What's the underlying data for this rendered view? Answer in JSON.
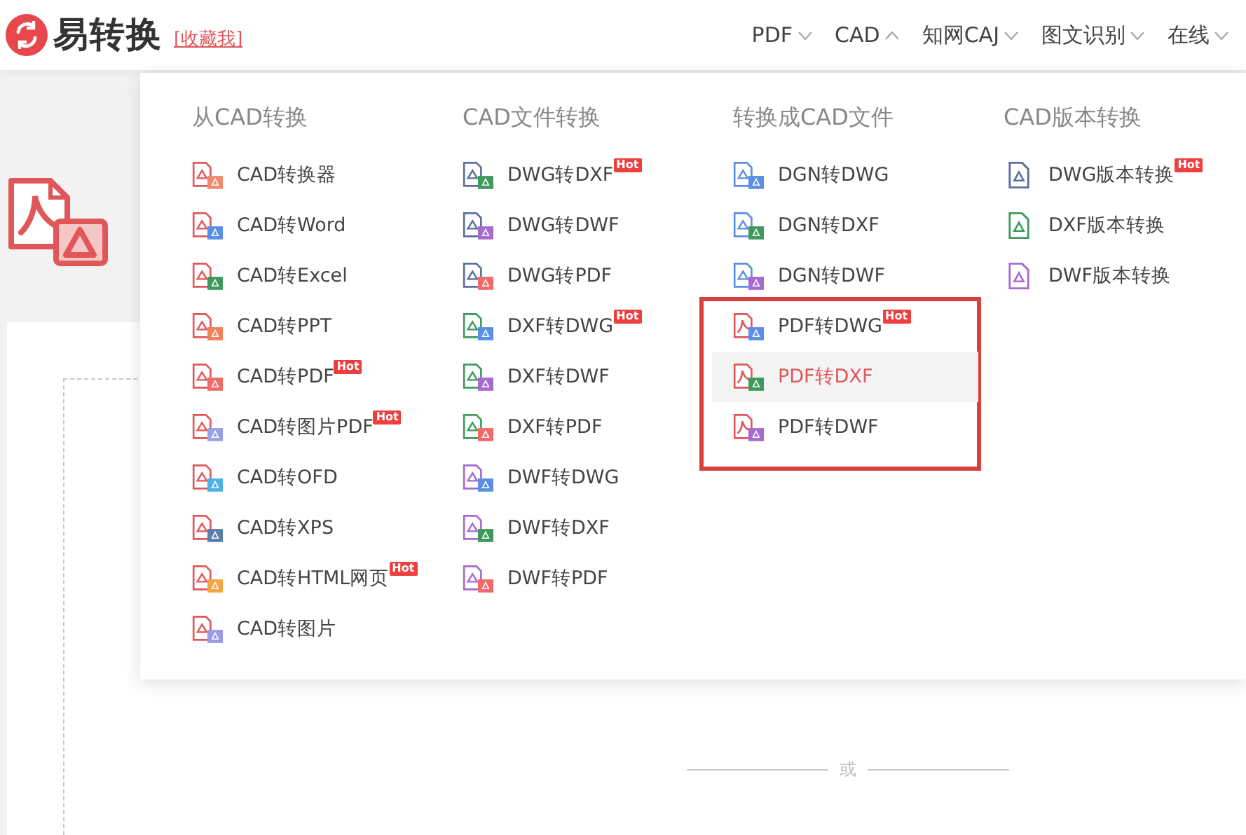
{
  "header": {
    "logo": "易转换",
    "bookmark": "[收藏我]",
    "nav": [
      {
        "label": "PDF",
        "expanded": false
      },
      {
        "label": "CAD",
        "expanded": true
      },
      {
        "label": "知网CAJ",
        "expanded": false
      },
      {
        "label": "图文识别",
        "expanded": false
      },
      {
        "label": "在线",
        "expanded": false
      }
    ]
  },
  "dropdown": {
    "columns": [
      {
        "title": "从CAD转换",
        "items": [
          {
            "label": "CAD转换器",
            "kind": "cad",
            "color": "#f08a6c",
            "selected": false
          },
          {
            "label": "CAD转Word",
            "kind": "cad",
            "color": "#5b8ee6",
            "selected": false
          },
          {
            "label": "CAD转Excel",
            "kind": "cad",
            "color": "#3e9a5c",
            "selected": false
          },
          {
            "label": "CAD转PPT",
            "kind": "cad",
            "color": "#f0805a",
            "selected": false
          },
          {
            "label": "CAD转PDF",
            "badge": "Hot",
            "kind": "cad",
            "color": "#f06a6a",
            "selected": false
          },
          {
            "label": "CAD转图片PDF",
            "badge": "Hot",
            "kind": "cad",
            "color": "#9aa0e8",
            "selected": false
          },
          {
            "label": "CAD转OFD",
            "kind": "cad",
            "color": "#4fb0ea",
            "selected": false
          },
          {
            "label": "CAD转XPS",
            "kind": "cad",
            "color": "#5a7fa8",
            "selected": false
          },
          {
            "label": "CAD转HTML网页",
            "badge": "Hot",
            "kind": "cad",
            "color": "#f5a442",
            "selected": false
          },
          {
            "label": "CAD转图片",
            "kind": "cad",
            "color": "#9a9ae8",
            "selected": false
          }
        ]
      },
      {
        "title": "CAD文件转换",
        "items": [
          {
            "label": "DWG转DXF",
            "badge": "Hot",
            "kind": "dwg",
            "color": "#3e9a5c",
            "selected": false
          },
          {
            "label": "DWG转DWF",
            "kind": "dwg",
            "color": "#a66ad0",
            "selected": false
          },
          {
            "label": "DWG转PDF",
            "kind": "dwg",
            "color": "#f06a6a",
            "selected": false
          },
          {
            "label": "DXF转DWG",
            "badge": "Hot",
            "kind": "dxf",
            "color": "#5b8ee6",
            "selected": false
          },
          {
            "label": "DXF转DWF",
            "kind": "dxf",
            "color": "#a66ad0",
            "selected": false
          },
          {
            "label": "DXF转PDF",
            "kind": "dxf",
            "color": "#f06a6a",
            "selected": false
          },
          {
            "label": "DWF转DWG",
            "kind": "dwf",
            "color": "#5b8ee6",
            "selected": false
          },
          {
            "label": "DWF转DXF",
            "kind": "dwf",
            "color": "#3e9a5c",
            "selected": false
          },
          {
            "label": "DWF转PDF",
            "kind": "dwf",
            "color": "#f06a6a",
            "selected": false
          }
        ]
      },
      {
        "title": "转换成CAD文件",
        "items": [
          {
            "label": "DGN转DWG",
            "kind": "dgn",
            "color": "#5b8ee6",
            "selected": false
          },
          {
            "label": "DGN转DXF",
            "kind": "dgn",
            "color": "#3e9a5c",
            "selected": false
          },
          {
            "label": "DGN转DWF",
            "kind": "dgn",
            "color": "#a66ad0",
            "selected": false
          }
        ],
        "highlighted_items": [
          {
            "label": "PDF转DWG",
            "badge": "Hot",
            "kind": "pdf",
            "color": "#5b8ee6",
            "selected": false
          },
          {
            "label": "PDF转DXF",
            "kind": "pdf",
            "color": "#3e9a5c",
            "selected": true
          },
          {
            "label": "PDF转DWF",
            "kind": "pdf",
            "color": "#a66ad0",
            "selected": false
          }
        ]
      },
      {
        "title": "CAD版本转换",
        "items": [
          {
            "label": "DWG版本转换",
            "badge": "Hot",
            "kind": "single",
            "color": "#5a6f9a",
            "selected": false
          },
          {
            "label": "DXF版本转换",
            "kind": "single",
            "color": "#3e9a5c",
            "selected": false
          },
          {
            "label": "DWF版本转换",
            "kind": "single",
            "color": "#a66ad0",
            "selected": false
          }
        ]
      }
    ]
  },
  "upload": {
    "divider": "或"
  }
}
